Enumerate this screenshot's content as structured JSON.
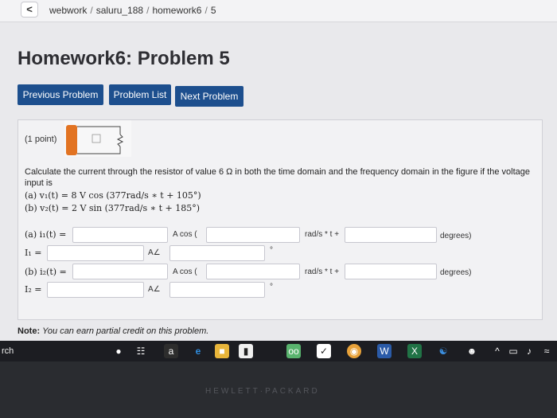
{
  "breadcrumb": {
    "back_icon": "chevron-left-icon",
    "items": [
      "webwork",
      "saluru_188",
      "homework6",
      "5"
    ],
    "separator": "/"
  },
  "page": {
    "title": "Homework6: Problem 5"
  },
  "nav": {
    "previous": "Previous Problem",
    "list": "Problem List",
    "next": "Next Problem",
    "accent": "#1d4f8e"
  },
  "problem": {
    "points": "(1 point)",
    "description": "Calculate the current through the resistor of value 6 Ω in both the time domain and the frequency domain in the figure if the voltage input is",
    "eq_a": "(a) v₁(t) = 8 V cos (377rad/s ∗ t + 105°)",
    "eq_b": "(b) v₂(t) = 2 V sin (377rad/s ∗ t + 185°)",
    "row_a_label": "(a) i₁(t) =",
    "row_I1_label": "I₁ =",
    "row_b_label": "(b) i₂(t) =",
    "row_I2_label": "I₂ =",
    "unit_cos": "A cos (",
    "unit_angle": "A∠",
    "unit_rads": "rad/s * t +",
    "unit_degrees": "degrees)",
    "unit_deg_symbol": "°"
  },
  "note": {
    "label": "Note:",
    "text": "You can earn partial credit on this problem."
  },
  "taskbar": {
    "search_fragment": "rch",
    "icons": [
      "microphone-icon",
      "task-view-icon",
      "amazon-icon",
      "edge-icon",
      "file-explorer-icon",
      "store-icon",
      "tripadvisor-icon",
      "app-icon",
      "chrome-icon",
      "word-icon",
      "excel-icon",
      "people-icon",
      "user-icon",
      "chevron-up-icon",
      "battery-icon",
      "volume-icon",
      "wifi-icon"
    ]
  },
  "bezel": {
    "brand": "HEWLETT·PACKARD"
  }
}
